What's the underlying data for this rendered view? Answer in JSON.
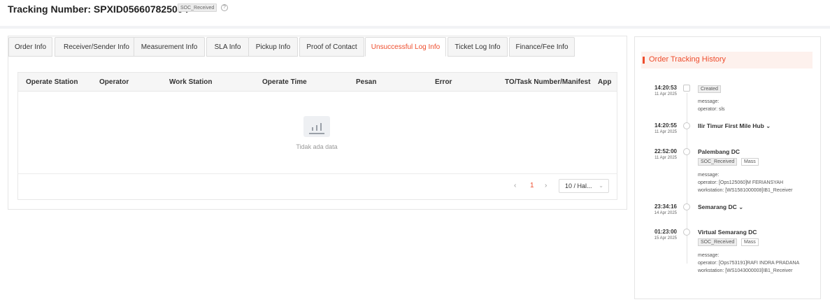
{
  "header": {
    "title": "Tracking Number: SPXID056607825004",
    "status_badge": "SOC_Received",
    "help_icon": "?"
  },
  "tabs": [
    {
      "label": "Order Info",
      "active": false
    },
    {
      "label": "Receiver/Sender Info",
      "active": false
    },
    {
      "label": "Measurement Info",
      "active": false
    },
    {
      "label": "SLA Info",
      "active": false
    },
    {
      "label": "Pickup Info",
      "active": false
    },
    {
      "label": "Proof of Contact",
      "active": false
    },
    {
      "label": "Unsuccessful Log Info",
      "active": true
    },
    {
      "label": "Ticket Log Info",
      "active": false
    },
    {
      "label": "Finance/Fee Info",
      "active": false
    }
  ],
  "table": {
    "columns": [
      "Operate Station",
      "Operator",
      "Work Station",
      "Operate Time",
      "Pesan",
      "Error",
      "TO/Task Number/Manifest",
      "App"
    ],
    "empty_text": "Tidak ada data"
  },
  "pagination": {
    "prev": "‹",
    "current_page": "1",
    "next": "›",
    "page_size": "10 / Hal...",
    "page_size_chevron": "⌄"
  },
  "tracking": {
    "title": "Order Tracking History",
    "events": [
      {
        "time": "14:20:53",
        "date": "11 Apr 2025",
        "title": "",
        "badge": "Created",
        "tag": "",
        "details": [
          "message:",
          "operator: sls"
        ]
      },
      {
        "time": "14:20:55",
        "date": "11 Apr 2025",
        "title": "Ilir Timur First Mile Hub",
        "expand": "⌄",
        "badge": "",
        "tag": "",
        "details": []
      },
      {
        "time": "22:52:00",
        "date": "11 Apr 2025",
        "title": "Palembang DC",
        "badge": "SOC_Received",
        "tag": "Mass",
        "details": [
          "message:",
          "operator: [Ops125060]M FERIANSYAH",
          "workstation: [WS1581000008]IB1_Receiver"
        ]
      },
      {
        "time": "23:34:16",
        "date": "14 Apr 2025",
        "title": "Semarang DC",
        "expand": "⌄",
        "badge": "",
        "tag": "",
        "details": []
      },
      {
        "time": "01:23:00",
        "date": "15 Apr 2025",
        "title": "Virtual Semarang DC",
        "badge": "SOC_Received",
        "tag": "Mass",
        "details": [
          "message:",
          "operator: [Ops753191]RAFI INDRA PRADANA",
          "workstation: [WS1043000003]IB1_Receiver"
        ]
      }
    ]
  },
  "colors": {
    "accent": "#ee4d2d",
    "header_tint": "#fdf1ed",
    "table_head": "#f6f6f6"
  }
}
